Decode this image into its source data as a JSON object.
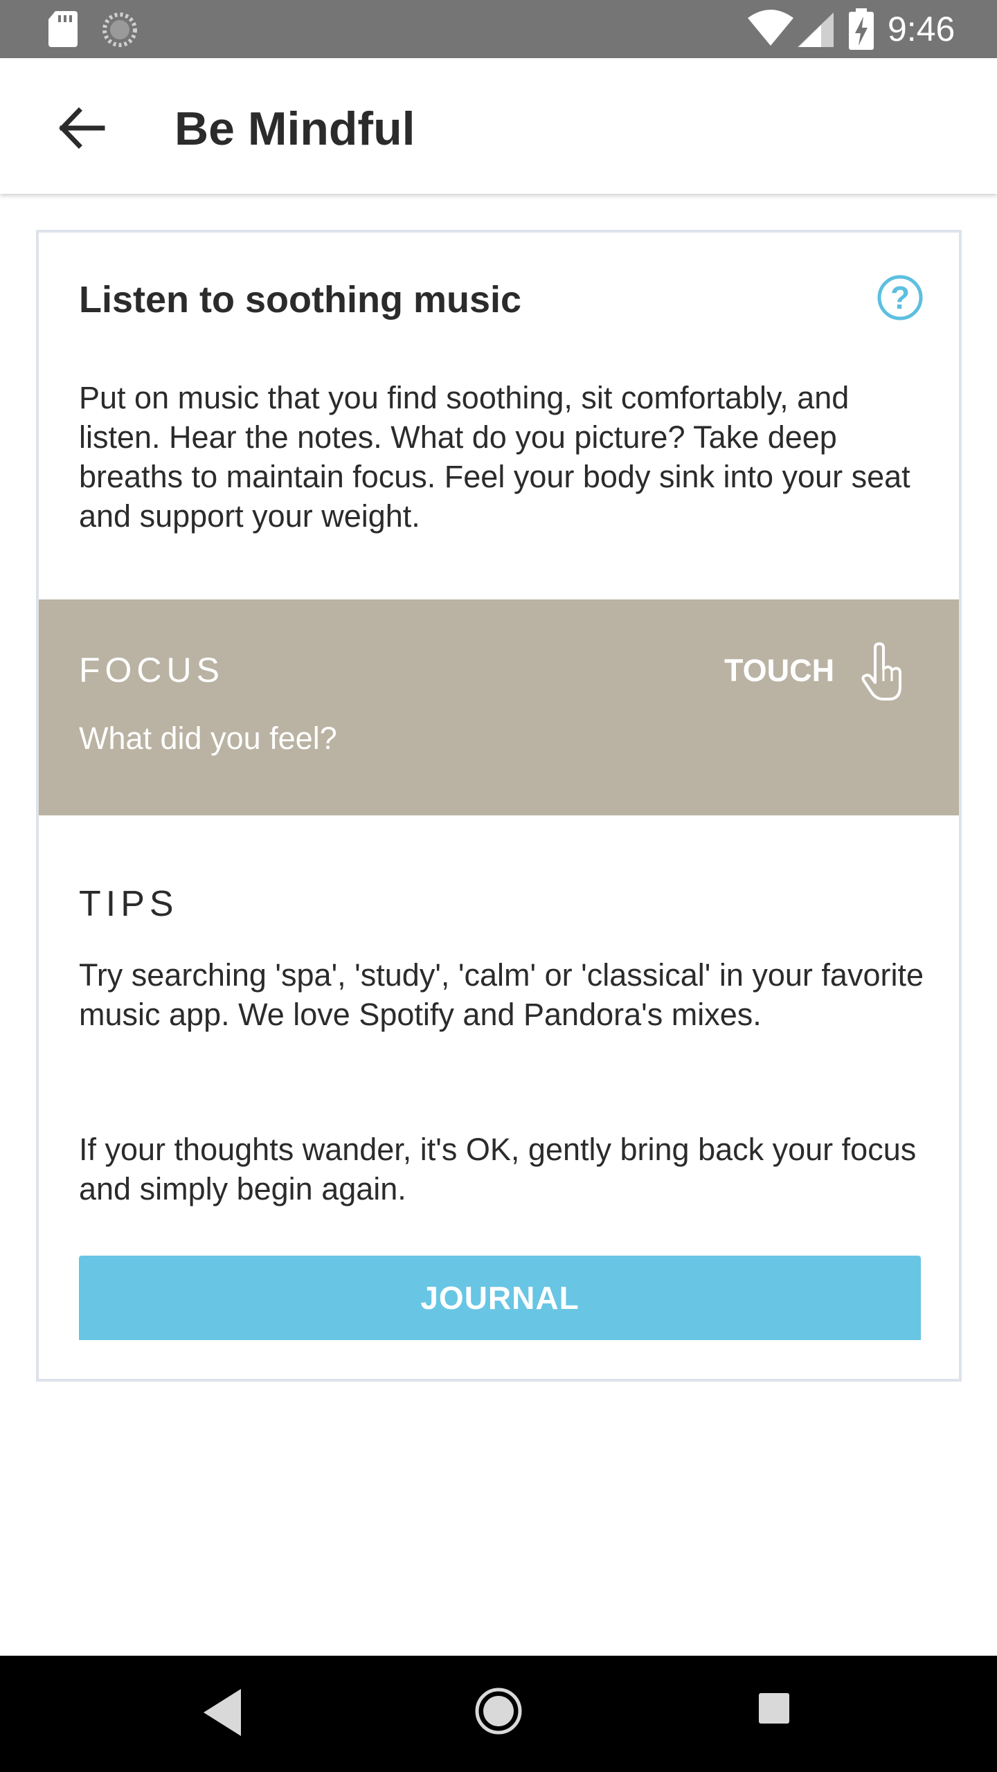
{
  "status_bar": {
    "time": "9:46",
    "icons": [
      "sd-card-icon",
      "sync-icon",
      "wifi-icon",
      "signal-icon",
      "battery-charging-icon"
    ]
  },
  "app_bar": {
    "title": "Be Mindful",
    "back_icon": "arrow-back-icon"
  },
  "card": {
    "title": "Listen to soothing music",
    "help_icon": "help-circle-icon",
    "description": "Put on music that you find soothing, sit comfortably, and listen. Hear the notes. What do you picture? Take deep breaths to maintain focus. Feel your body sink into your seat and support your weight.",
    "focus": {
      "label": "FOCUS",
      "prompt": "What did you feel?",
      "touch_label": "TOUCH",
      "touch_icon": "hand-pointer-icon",
      "background_color": "#bab3a3"
    },
    "tips": {
      "label": "TIPS",
      "paragraphs": [
        "Try searching 'spa', 'study', 'calm' or 'classical' in your favorite music app. We love Spotify and Pandora's mixes.",
        "If your thoughts wander, it's OK, gently bring back your focus and simply begin again."
      ]
    },
    "journal_button": {
      "label": "JOURNAL",
      "color": "#68c5e4"
    }
  },
  "nav_bar": {
    "icons": [
      "nav-back-icon",
      "nav-home-icon",
      "nav-recents-icon"
    ]
  }
}
